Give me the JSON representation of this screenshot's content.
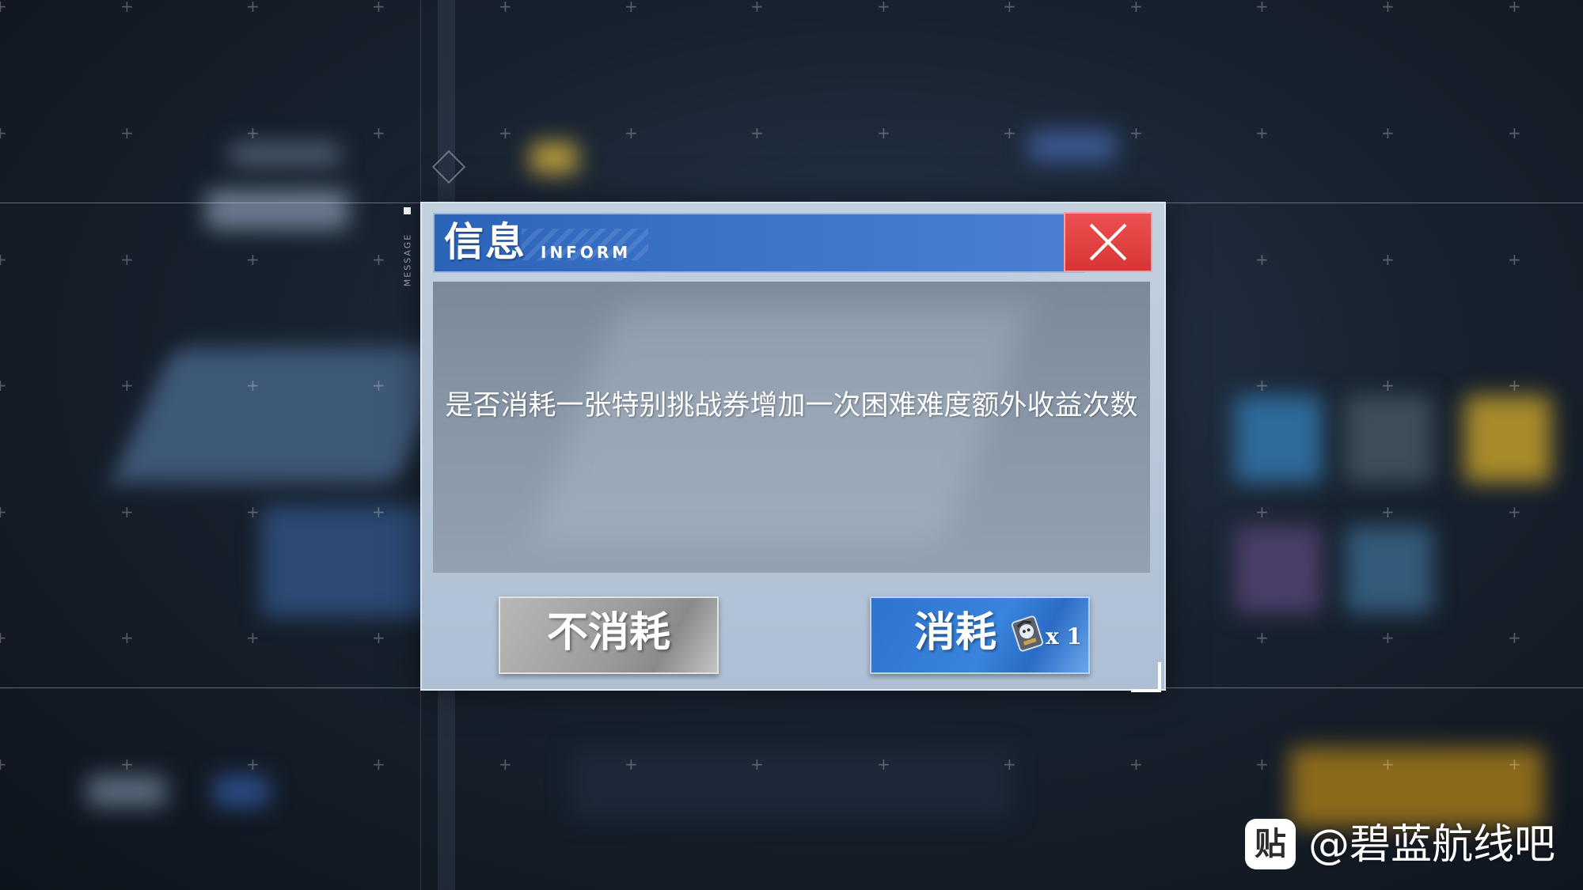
{
  "dialog": {
    "title": "信息",
    "subtitle": "INFORM",
    "side_label": "MESSAGE",
    "message": "是否消耗一张特别挑战券增加一次困难难度额外收益次数",
    "cancel_label": "不消耗",
    "confirm_label": "消耗",
    "cost_count": "x 1",
    "cost_icon": "challenge-ticket-icon",
    "close_icon": "close-icon"
  },
  "watermark": {
    "logo_char": "贴",
    "text": "@碧蓝航线吧"
  },
  "colors": {
    "title_bar": "#3a72c8",
    "close_button": "#e04444",
    "confirm_button": "#3a84dd",
    "cancel_button": "#9a9a9a",
    "dialog_bg": "#b6c6d8"
  }
}
